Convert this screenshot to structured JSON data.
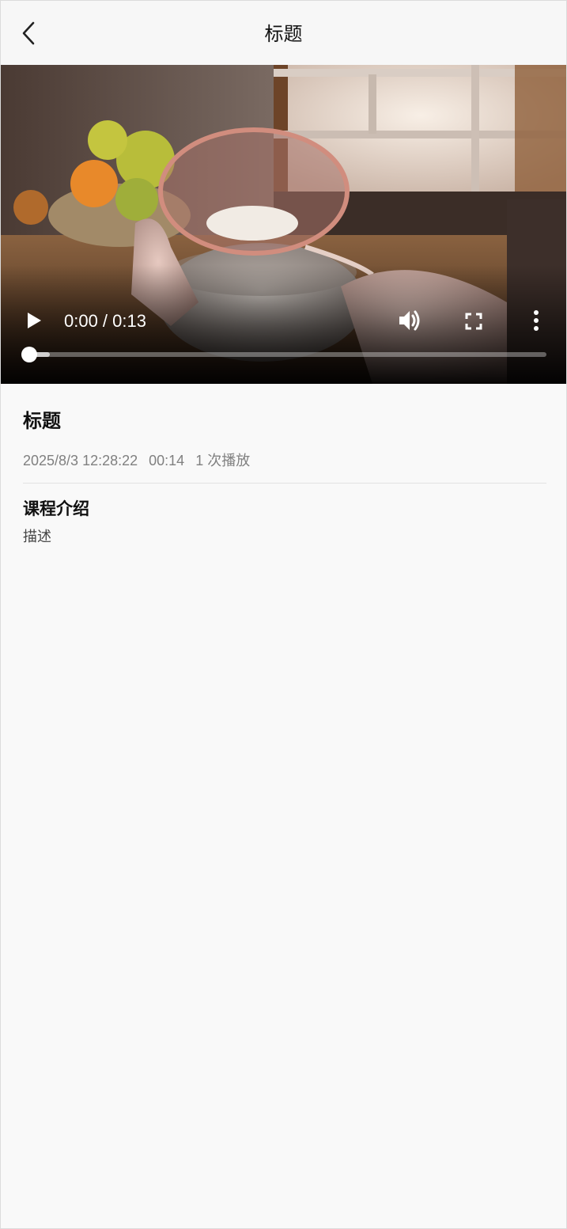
{
  "header": {
    "title": "标题",
    "back_icon": "chevron-left-icon"
  },
  "video": {
    "time_display": "0:00 / 0:13",
    "progress_fraction": 0,
    "buffered_fraction": 0.04,
    "icons": {
      "play": "play-icon",
      "volume": "volume-icon",
      "fullscreen": "fullscreen-icon",
      "more": "more-vertical-icon"
    }
  },
  "details": {
    "title": "标题",
    "date": "2025/8/3 12:28:22",
    "duration": "00:14",
    "plays": "1 次播放",
    "section_title": "课程介绍",
    "description": "描述"
  },
  "colors": {
    "page_bg": "#f9f9f9",
    "meta_text": "#808080"
  }
}
